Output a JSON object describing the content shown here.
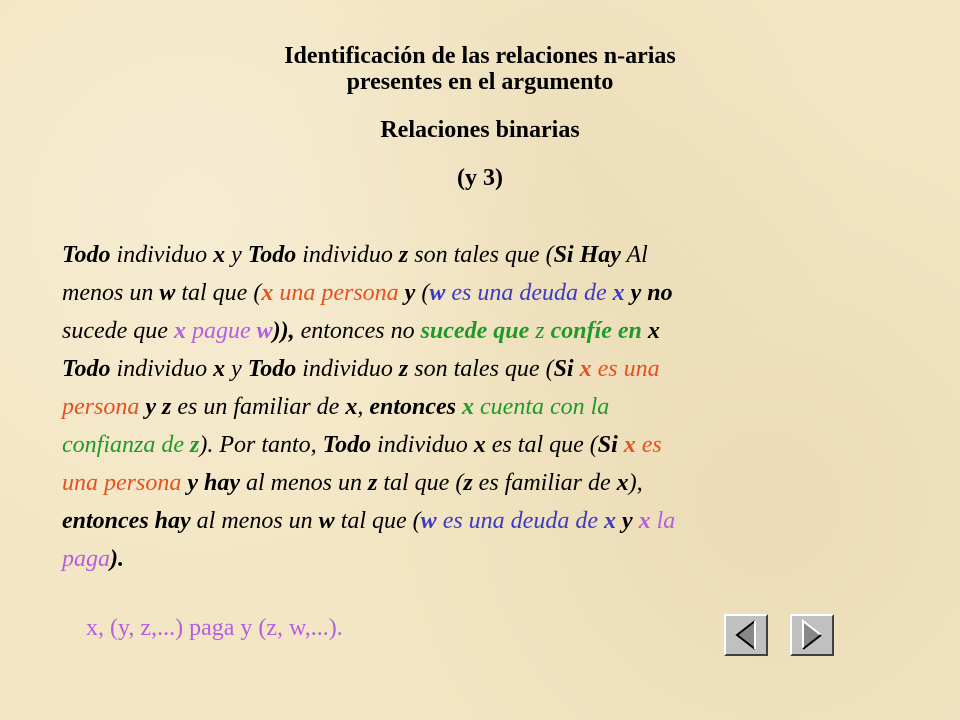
{
  "title": {
    "line1": "Identificación de las relaciones n-arias",
    "line2": "presentes en el argumento",
    "subtitle": "Relaciones binarias",
    "part": "(y 3)"
  },
  "paragraph": {
    "l1": [
      "Todo",
      " individuo ",
      "x",
      " y ",
      "Todo",
      " individuo ",
      "z",
      " son tales que (",
      "Si",
      "  ",
      "Hay",
      " Al"
    ],
    "l2": [
      "menos un ",
      "w",
      " tal que (",
      "x",
      " una persona ",
      "y",
      " (",
      "w",
      " es una deuda de ",
      "x",
      " ",
      "y",
      " ",
      "no"
    ],
    "l3": [
      "sucede que ",
      "x",
      " pague ",
      "w",
      ")), ",
      "entonces no",
      " sucede que ",
      "z",
      " confíe en ",
      "x",
      ")."
    ],
    "l4": [
      "Todo",
      " individuo ",
      "x",
      " y ",
      "Todo",
      " individuo ",
      "z",
      " son tales que (",
      "Si",
      " ",
      "x",
      " es una"
    ],
    "l5": [
      "persona",
      " ",
      "y",
      " ",
      "z",
      " es un familiar de ",
      "x",
      ", ",
      "entonces",
      " ",
      "x",
      " cuenta con la"
    ],
    "l6": [
      "confianza de ",
      "z",
      "). Por tanto, ",
      "Todo",
      " individuo ",
      "x",
      " es tal que (",
      "Si",
      "  ",
      "x",
      " es"
    ],
    "l7": [
      "una persona",
      " ",
      "y hay",
      " al menos un ",
      "z",
      " tal que (",
      "z",
      " es familiar de ",
      "x",
      "),"
    ],
    "l8": [
      "entonces hay",
      " al menos un ",
      "w",
      " tal que (",
      "w",
      " es una deuda de ",
      "x",
      " ",
      "y",
      " ",
      "x",
      " la"
    ],
    "l9": [
      "paga",
      ")."
    ]
  },
  "bottom_text": "x, (y, z,...) paga y (z, w,...).",
  "nav": {
    "prev_icon": "triangle-left-icon",
    "next_icon": "triangle-right-icon"
  },
  "colors": {
    "background": "#f3e6c4",
    "orange": "#e8501e",
    "blue": "#3a3ac4",
    "green": "#1e9a2a",
    "violet": "#b45ee0"
  }
}
